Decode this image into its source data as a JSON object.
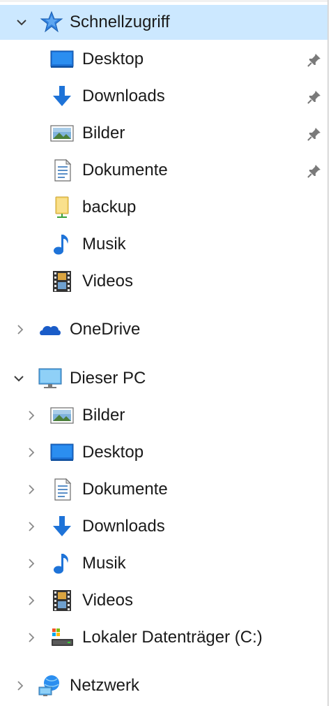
{
  "quick_access": {
    "title": "Schnellzugriff",
    "items": [
      {
        "label": "Desktop",
        "icon": "desktop-icon",
        "pinned": true
      },
      {
        "label": "Downloads",
        "icon": "downloads-icon",
        "pinned": true
      },
      {
        "label": "Bilder",
        "icon": "pictures-icon",
        "pinned": true
      },
      {
        "label": "Dokumente",
        "icon": "documents-icon",
        "pinned": true
      },
      {
        "label": "backup",
        "icon": "folder-icon",
        "pinned": false
      },
      {
        "label": "Musik",
        "icon": "music-icon",
        "pinned": false
      },
      {
        "label": "Videos",
        "icon": "videos-icon",
        "pinned": false
      }
    ]
  },
  "onedrive": {
    "label": "OneDrive",
    "icon": "onedrive-icon"
  },
  "this_pc": {
    "title": "Dieser PC",
    "items": [
      {
        "label": "Bilder",
        "icon": "pictures-icon"
      },
      {
        "label": "Desktop",
        "icon": "desktop-icon"
      },
      {
        "label": "Dokumente",
        "icon": "documents-icon"
      },
      {
        "label": "Downloads",
        "icon": "downloads-icon"
      },
      {
        "label": "Musik",
        "icon": "music-icon"
      },
      {
        "label": "Videos",
        "icon": "videos-icon"
      },
      {
        "label": "Lokaler Datenträger (C:)",
        "icon": "drive-icon"
      }
    ]
  },
  "network": {
    "label": "Netzwerk",
    "icon": "network-icon"
  },
  "colors": {
    "selection": "#cce8ff",
    "accent_blue": "#1e73d8",
    "chevron": "#6d6d6d",
    "pin": "#7a7a7a"
  }
}
